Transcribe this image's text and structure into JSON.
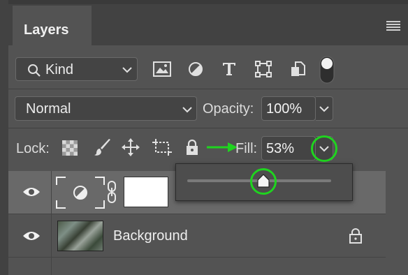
{
  "panel": {
    "tab_title": "Layers",
    "menu_icon": "hamburger-menu-icon"
  },
  "filter": {
    "kind_label": "Kind",
    "icons": [
      "image-filter-icon",
      "adjustment-filter-icon",
      "type-filter-icon",
      "shape-filter-icon",
      "smart-object-filter-icon",
      "filter-toggle-icon"
    ]
  },
  "blend": {
    "mode": "Normal",
    "opacity_label": "Opacity:",
    "opacity_value": "100%"
  },
  "lock": {
    "label": "Lock:",
    "icons": [
      "lock-transparent-pixels-icon",
      "lock-image-pixels-icon",
      "lock-position-icon",
      "lock-artboard-icon",
      "lock-all-icon"
    ],
    "fill_label": "Fill:",
    "fill_value": "53%",
    "fill_slider_fraction": 0.53
  },
  "layers": [
    {
      "name": "",
      "type": "adjustment",
      "visible": true,
      "selected": true
    },
    {
      "name": "Background",
      "type": "image",
      "visible": true,
      "locked": true
    }
  ],
  "annotation_color": "#1fd41f"
}
